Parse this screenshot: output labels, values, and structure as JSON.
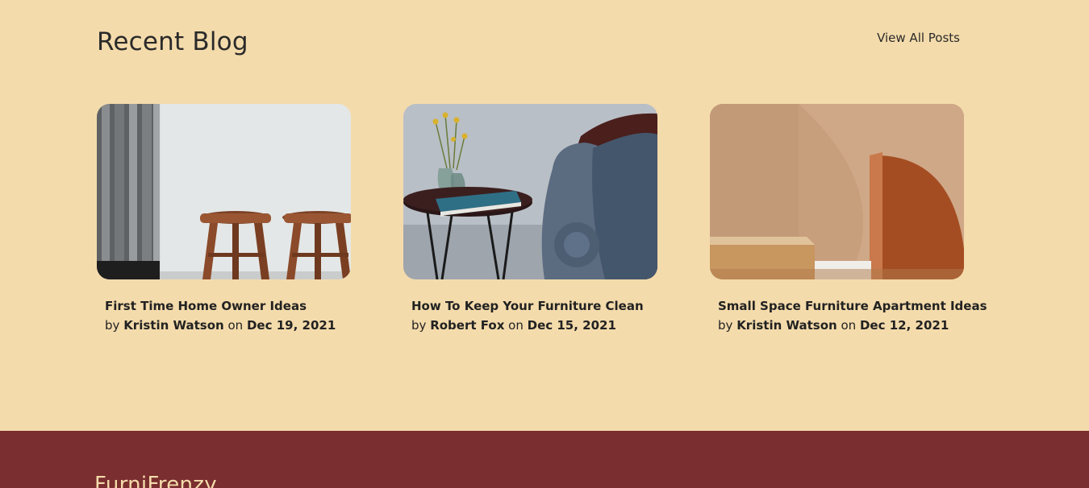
{
  "blog": {
    "title": "Recent Blog",
    "view_all": "View All Posts",
    "posts": [
      {
        "title": "First Time Home Owner Ideas",
        "by": "by",
        "author": "Kristin Watson",
        "on": "on",
        "date": "Dec 19, 2021",
        "image": "stools-image"
      },
      {
        "title": "How To Keep Your Furniture Clean",
        "by": "by",
        "author": "Robert Fox",
        "on": "on",
        "date": "Dec 15, 2021",
        "image": "side-table-sofa-image"
      },
      {
        "title": "Small Space Furniture Apartment Ideas",
        "by": "by",
        "author": "Kristin Watson",
        "on": "on",
        "date": "Dec 12, 2021",
        "image": "abstract-shapes-image"
      }
    ]
  },
  "footer": {
    "brand": "FurniFrenzy"
  },
  "colors": {
    "background": "#f4dbab",
    "footer": "#7a2e2f",
    "text": "#222222"
  }
}
